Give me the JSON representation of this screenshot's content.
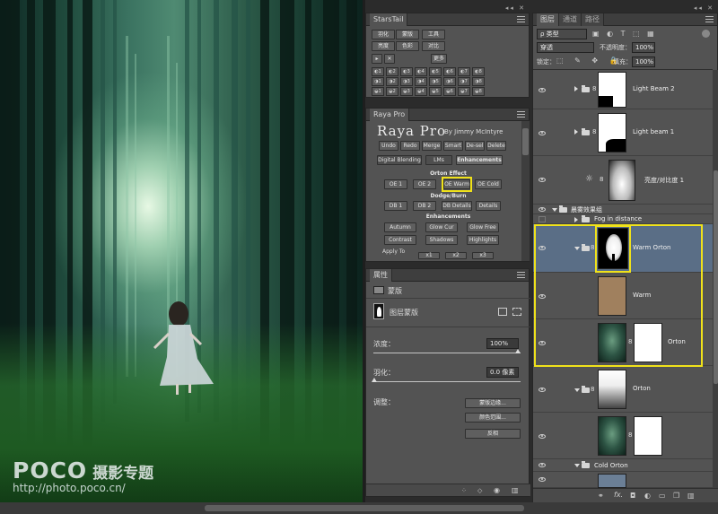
{
  "photo": {
    "watermark_logo": "POCO",
    "watermark_tag": "摄影专题",
    "watermark_url": "http://photo.poco.cn/"
  },
  "starstail": {
    "tab": "StarsTail",
    "row1": [
      "羽化",
      "蒙版",
      "工具"
    ],
    "row2": [
      "亮度",
      "色彩",
      "对比"
    ],
    "more": "更多",
    "grid": [
      "◐1",
      "◐2",
      "◐3",
      "◐4",
      "◐5",
      "◐6",
      "◐7",
      "◐8",
      "◑1",
      "◑2",
      "◑3",
      "◑4",
      "◑5",
      "◑6",
      "◑7",
      "◑8",
      "◒1",
      "◒2",
      "◒3",
      "◒4",
      "◒5",
      "◒6",
      "◒7",
      "◒8"
    ]
  },
  "raya": {
    "tab": "Raya Pro",
    "title": "Raya Pro",
    "by": "By Jimmy McIntyre",
    "top_buttons": [
      "Undo",
      "Redo",
      "Merge",
      "Smart",
      "De-sel",
      "Delete"
    ],
    "tabs": [
      "Digital Blending",
      "LMs",
      "Enhancements"
    ],
    "orton_heading": "Orton Effect",
    "orton_buttons": [
      "OE 1",
      "OE 2",
      "OE Warm",
      "OE Cold"
    ],
    "dodge_heading": "Dodge/Burn",
    "dodge_buttons": [
      "DB 1",
      "DB 2",
      "DB Details",
      "Details"
    ],
    "enh_heading": "Enhancements",
    "enh_row1": [
      "Autumn",
      "Glow Cur",
      "Glow Free"
    ],
    "enh_row2": [
      "Contrast",
      "Shadows",
      "Highlights"
    ],
    "apply_to": "Apply To",
    "apply_buttons": [
      "x1",
      "x2",
      "x3"
    ]
  },
  "props": {
    "tab": "属性",
    "section": "蒙版",
    "mask_label": "图层蒙版",
    "density_label": "浓度：",
    "density_value": "100%",
    "feather_label": "羽化：",
    "feather_value": "0.0 像素",
    "adjust_label": "调整：",
    "buttons": [
      "蒙版边缘...",
      "颜色范围...",
      "反相"
    ]
  },
  "layers": {
    "tabs": [
      "图层",
      "通道",
      "路径"
    ],
    "filter_kind": "ρ 类型",
    "blend_mode": "穿透",
    "opacity_label": "不透明度：",
    "opacity_value": "100%",
    "lock_label": "锁定：",
    "fill_label": "填充：",
    "fill_value": "100%",
    "items": [
      {
        "name": "Light Beam 2"
      },
      {
        "name": "Light beam 1"
      },
      {
        "name": "亮度/对比度 1"
      },
      {
        "name": "晨雾效果组"
      },
      {
        "name": "Fog in distance"
      },
      {
        "name": "Warm Orton"
      },
      {
        "name": "Warm"
      },
      {
        "name": "Orton"
      },
      {
        "name": "Orton"
      },
      {
        "name": ""
      },
      {
        "name": "Cold Orton"
      }
    ]
  },
  "colors": {
    "highlight": "#f0e21a",
    "selected_layer": "#5a6e86",
    "panel": "#535353",
    "warm_fill": "#a0805e"
  }
}
